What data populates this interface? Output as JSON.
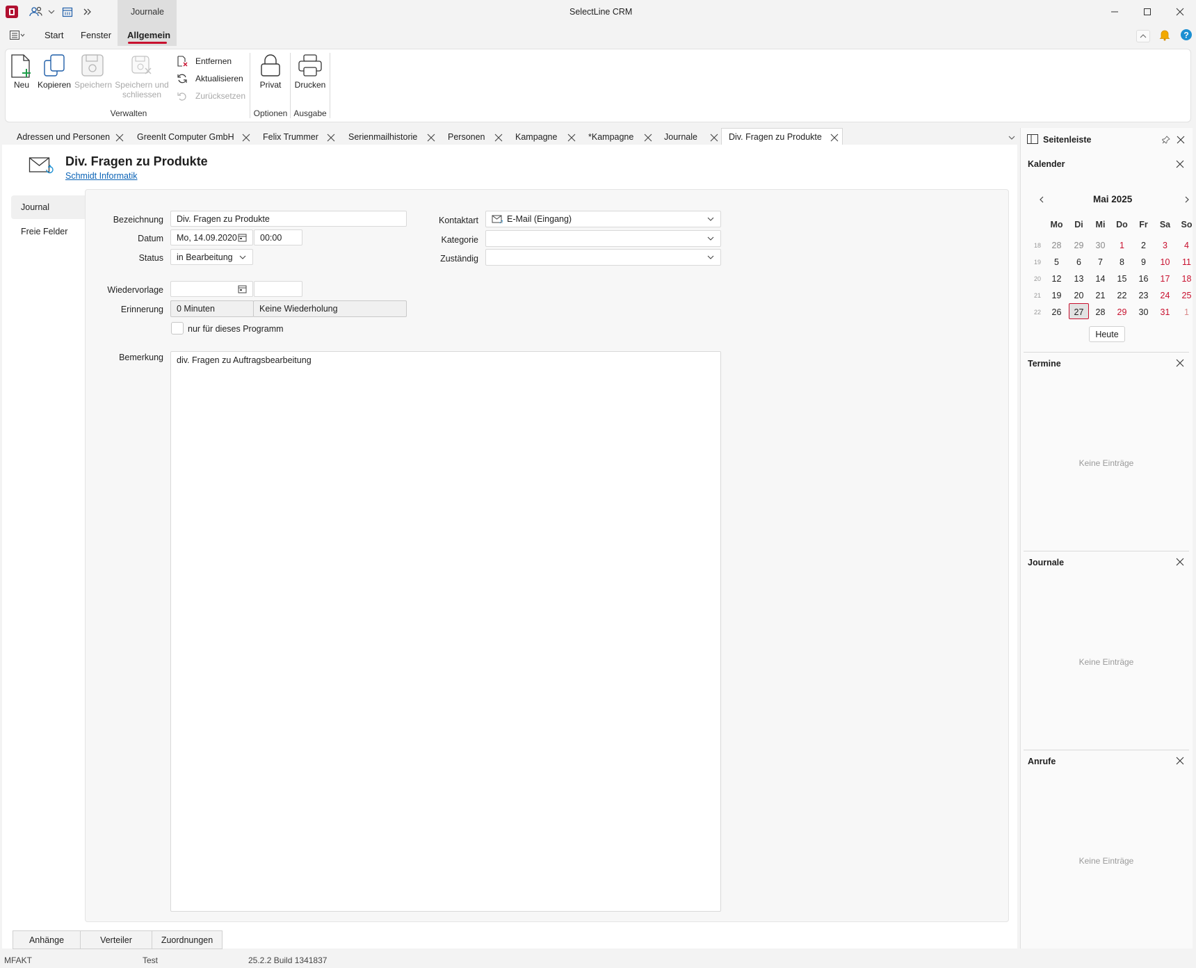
{
  "app": {
    "title": "SelectLine CRM",
    "context_tab": "Journale"
  },
  "ribbon_tabs": [
    "Start",
    "Fenster",
    "Allgemein"
  ],
  "ribbon": {
    "verwalten": {
      "neu": "Neu",
      "kopieren": "Kopieren",
      "speichern": "Speichern",
      "speichern_schliessen_1": "Speichern und",
      "speichern_schliessen_2": "schliessen",
      "entfernen": "Entfernen",
      "aktualisieren": "Aktualisieren",
      "zuruecksetzen": "Zurücksetzen",
      "group": "Verwalten"
    },
    "optionen": {
      "privat": "Privat",
      "group": "Optionen"
    },
    "ausgabe": {
      "drucken": "Drucken",
      "group": "Ausgabe"
    }
  },
  "doc_tabs": [
    "Adressen und Personen",
    "GreenIt Computer GmbH",
    "Felix Trummer",
    "Serienmailhistorie",
    "Personen",
    "Kampagne",
    "*Kampagne",
    "Journale",
    "Div. Fragen zu Produkte"
  ],
  "record": {
    "title": "Div. Fragen zu Produkte",
    "link": "Schmidt Informatik"
  },
  "nav": [
    "Journal",
    "Freie Felder"
  ],
  "form": {
    "bezeichnung_label": "Bezeichnung",
    "bezeichnung_value": "Div. Fragen zu Produkte",
    "datum_label": "Datum",
    "datum_value": "Mo, 14.09.2020",
    "zeit_value": "00:00",
    "status_label": "Status",
    "status_value": "in Bearbeitung",
    "wiedervorlage_label": "Wiedervorlage",
    "erinnerung_label": "Erinnerung",
    "erinnerung_minuten": "0 Minuten",
    "erinnerung_wiederholung": "Keine Wiederholung",
    "checkbox_label": "nur für dieses Programm",
    "kontaktart_label": "Kontaktart",
    "kontaktart_value": "E-Mail (Eingang)",
    "kategorie_label": "Kategorie",
    "zustaendig_label": "Zuständig",
    "bemerkung_label": "Bemerkung",
    "bemerkung_value": "div. Fragen zu Auftragsbearbeitung"
  },
  "bottom_tabs": [
    "Anhänge",
    "Verteiler",
    "Zuordnungen"
  ],
  "status_bar": {
    "app": "MFAKT",
    "mandant": "Test",
    "version": "25.2.2 Build 1341837"
  },
  "sidebar": {
    "title": "Seitenleiste",
    "calendar": {
      "title": "Kalender",
      "month": "Mai 2025",
      "weekdays": [
        "Mo",
        "Di",
        "Mi",
        "Do",
        "Fr",
        "Sa",
        "So"
      ],
      "weeks": [
        {
          "kw": "18",
          "days": [
            "28",
            "29",
            "30",
            "1",
            "2",
            "3",
            "4"
          ]
        },
        {
          "kw": "19",
          "days": [
            "5",
            "6",
            "7",
            "8",
            "9",
            "10",
            "11"
          ]
        },
        {
          "kw": "20",
          "days": [
            "12",
            "13",
            "14",
            "15",
            "16",
            "17",
            "18"
          ]
        },
        {
          "kw": "21",
          "days": [
            "19",
            "20",
            "21",
            "22",
            "23",
            "24",
            "25"
          ]
        },
        {
          "kw": "22",
          "days": [
            "26",
            "27",
            "28",
            "29",
            "30",
            "31",
            "1"
          ]
        }
      ],
      "today_button": "Heute"
    },
    "termine": {
      "title": "Termine",
      "empty": "Keine Einträge"
    },
    "journale": {
      "title": "Journale",
      "empty": "Keine Einträge"
    },
    "anrufe": {
      "title": "Anrufe",
      "empty": "Keine Einträge"
    }
  },
  "colors": {
    "accent": "#c8102e",
    "link": "#0b63b6",
    "disabled": "#a8a8a8"
  }
}
